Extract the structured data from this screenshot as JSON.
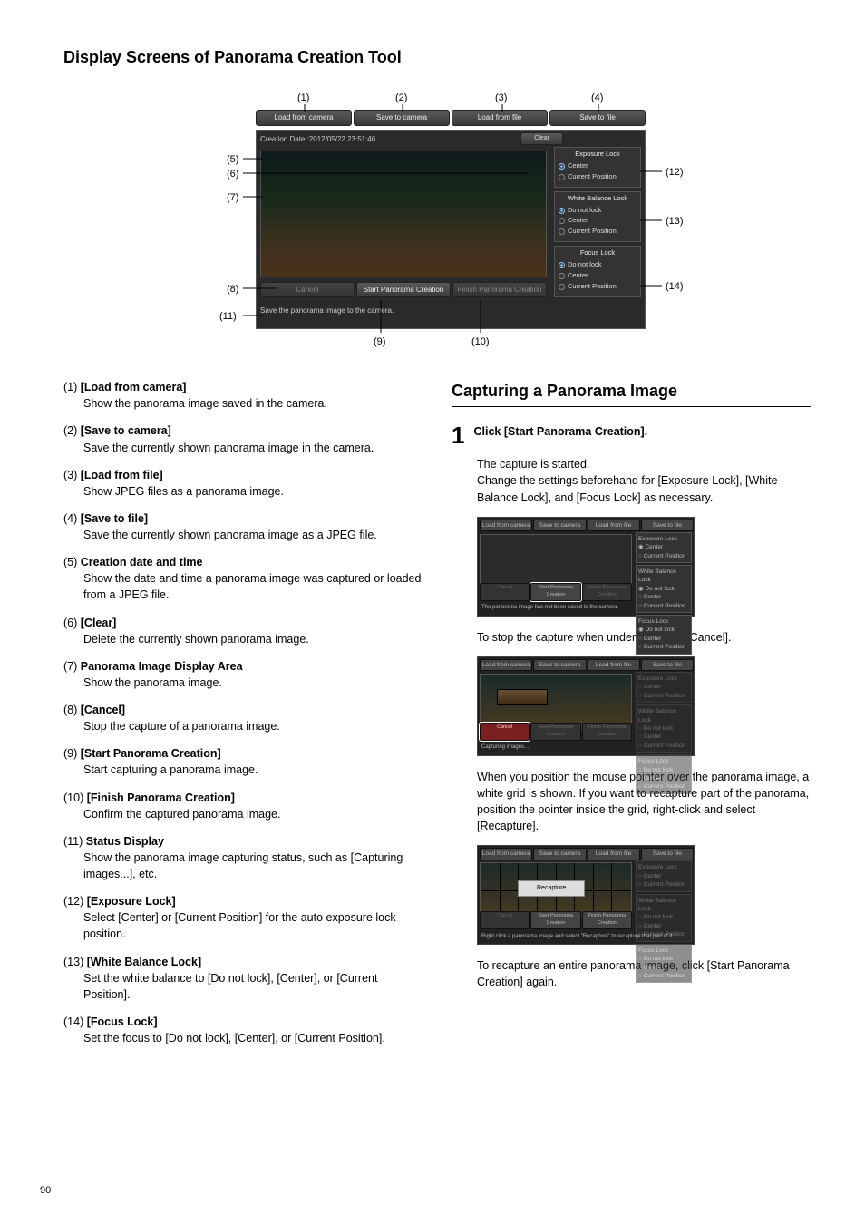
{
  "page_number": "90",
  "heading1": "Display Screens of Panorama Creation Tool",
  "ui": {
    "btn_load_camera": "Load from camera",
    "btn_save_camera": "Save to camera",
    "btn_load_file": "Load from file",
    "btn_save_file": "Save to file",
    "date_line": "Creation Date :2012/05/22 23:51:46",
    "btn_clear": "Clear",
    "btn_cancel": "Cancel",
    "btn_start": "Start Panorama Creation",
    "btn_finish": "Finish Panorama Creation",
    "status_line": "Save the panorama image to the camera.",
    "grp_exposure": "Exposure Lock",
    "grp_wb": "White Balance Lock",
    "grp_focus": "Focus Lock",
    "opt_nolock": "Do not lock",
    "opt_center": "Center",
    "opt_current": "Current Position"
  },
  "callouts": {
    "c1": "(1)",
    "c2": "(2)",
    "c3": "(3)",
    "c4": "(4)",
    "c5": "(5)",
    "c6": "(6)",
    "c7": "(7)",
    "c8": "(8)",
    "c9": "(9)",
    "c10": "(10)",
    "c11": "(11)",
    "c12": "(12)",
    "c13": "(13)",
    "c14": "(14)"
  },
  "items": [
    {
      "n": "(1)",
      "t": "[Load from camera]",
      "d": "Show the panorama image saved in the camera."
    },
    {
      "n": "(2)",
      "t": "[Save to camera]",
      "d": "Save the currently shown panorama image in the camera."
    },
    {
      "n": "(3)",
      "t": "[Load from file]",
      "d": "Show JPEG files as a panorama image."
    },
    {
      "n": "(4)",
      "t": "[Save to file]",
      "d": "Save the currently shown panorama image as a JPEG file."
    },
    {
      "n": "(5)",
      "t": "Creation date and time",
      "d": "Show the date and time a panorama image was captured or loaded from a JPEG file."
    },
    {
      "n": "(6)",
      "t": "[Clear]",
      "d": "Delete the currently shown panorama image."
    },
    {
      "n": "(7)",
      "t": "Panorama Image Display Area",
      "d": "Show the panorama image."
    },
    {
      "n": "(8)",
      "t": "[Cancel]",
      "d": "Stop the capture of a panorama image."
    },
    {
      "n": "(9)",
      "t": "[Start Panorama Creation]",
      "d": "Start capturing a panorama image."
    },
    {
      "n": "(10)",
      "t": "[Finish Panorama Creation]",
      "d": "Confirm the captured panorama image."
    },
    {
      "n": "(11)",
      "t": "Status Display",
      "d": "Show the panorama image capturing status, such as [Capturing images...], etc."
    },
    {
      "n": "(12)",
      "t": "[Exposure Lock]",
      "d": "Select [Center] or [Current Position] for the auto exposure lock position."
    },
    {
      "n": "(13)",
      "t": "[White Balance Lock]",
      "d": "Set the white balance to [Do not lock], [Center], or [Current Position]."
    },
    {
      "n": "(14)",
      "t": "[Focus Lock]",
      "d": "Set the focus to [Do not lock], [Center], or [Current Position]."
    }
  ],
  "heading2": "Capturing a Panorama Image",
  "step1_num": "1",
  "step1_text": "Click [Start Panorama Creation].",
  "right": {
    "p1": "The capture is started.",
    "p2": "Change the settings beforehand for [Exposure Lock], [White Balance Lock], and [Focus Lock] as necessary.",
    "p3": "To stop the capture when underway, click [Cancel].",
    "p4": "When you position the mouse pointer over the panorama image, a white grid is shown. If you want to recapture part of the panorama, position the pointer inside the grid, right-click and select [Recapture].",
    "p5": "To recapture an entire panorama image, click [Start Panorama Creation] again."
  },
  "mini1": {
    "status": "The panorama image has not been saved to the camera.",
    "start_outline": true
  },
  "mini2": {
    "status": "Capturing images...",
    "cancel_red": true
  },
  "mini3": {
    "status": "Right click a panorama image and select \"Recapture\" to recapture that part of it.",
    "menu": "Recapture"
  }
}
